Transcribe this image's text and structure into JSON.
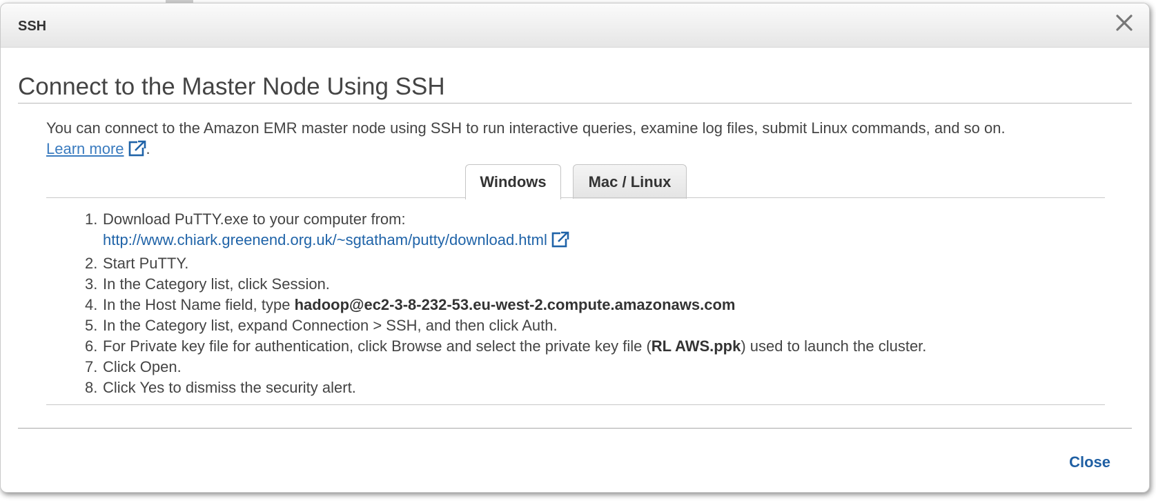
{
  "dialog": {
    "title": "SSH",
    "heading": "Connect to the Master Node Using SSH",
    "intro_text": "You can connect to the Amazon EMR master node using SSH to run interactive queries, examine log files, submit Linux commands, and so on.",
    "learn_more": "Learn more",
    "learn_more_suffix": ".",
    "close_label": "Close"
  },
  "tabs": [
    {
      "label": "Windows",
      "selected": true
    },
    {
      "label": "Mac / Linux",
      "selected": false
    }
  ],
  "steps": [
    {
      "num": "1.",
      "text": "Download PuTTY.exe to your computer from:",
      "link": "http://www.chiark.greenend.org.uk/~sgtatham/putty/download.html"
    },
    {
      "num": "2.",
      "text": "Start PuTTY."
    },
    {
      "num": "3.",
      "text": "In the Category list, click Session."
    },
    {
      "num": "4.",
      "pre": "In the Host Name field, type ",
      "bold": "hadoop@ec2-3-8-232-53.eu-west-2.compute.amazonaws.com",
      "post": ""
    },
    {
      "num": "5.",
      "text": "In the Category list, expand Connection > SSH, and then click Auth."
    },
    {
      "num": "6.",
      "pre": "For Private key file for authentication, click Browse and select the private key file (",
      "bold": "RL AWS.ppk",
      "post": ") used to launch the cluster."
    },
    {
      "num": "7.",
      "text": "Click Open."
    },
    {
      "num": "8.",
      "text": "Click Yes to dismiss the security alert."
    }
  ],
  "colors": {
    "link": "#1f63a8",
    "learn_more": "#3a7bbf",
    "close_button": "#1f5fa3",
    "text": "#444444"
  },
  "icons": {
    "close": "close-x-icon",
    "external": "external-link-icon"
  }
}
